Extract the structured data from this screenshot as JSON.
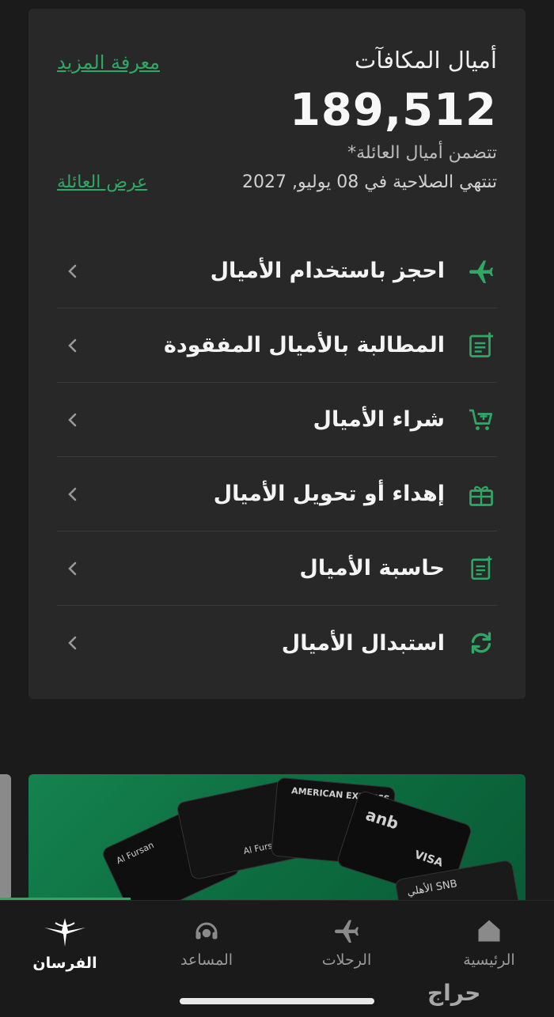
{
  "colors": {
    "accent": "#2fa866",
    "card": "#282828",
    "background": "#1b1b1b"
  },
  "rewards": {
    "title": "أميال المكافآت",
    "learn_more": "معرفة المزيد",
    "miles": "189,512",
    "family_note": "تتضمن أميال العائلة*",
    "expiry": "تنتهي الصلاحية في 08 يوليو, 2027",
    "view_family": "عرض العائلة"
  },
  "menu": [
    {
      "label": "احجز باستخدام الأميال",
      "icon": "airplane-icon"
    },
    {
      "label": "المطالبة بالأميال المفقودة",
      "icon": "document-add-icon"
    },
    {
      "label": "شراء الأميال",
      "icon": "cart-add-icon"
    },
    {
      "label": "إهداء أو تحويل الأميال",
      "icon": "gift-icon"
    },
    {
      "label": "حاسبة الأميال",
      "icon": "calculator-doc-icon"
    },
    {
      "label": "استبدال الأميال",
      "icon": "exchange-icon"
    }
  ],
  "banner": {
    "cards": [
      "Al Fursan",
      "AMERICAN EXPRESS",
      "anb",
      "VISA",
      "SNB الأهلي"
    ]
  },
  "tabs": [
    {
      "label": "الرئيسية",
      "icon": "home-icon"
    },
    {
      "label": "الرحلات",
      "icon": "airplane-icon"
    },
    {
      "label": "المساعد",
      "icon": "headset-icon"
    },
    {
      "label": "الفرسان",
      "icon": "alfursan-logo-icon",
      "active": true
    }
  ],
  "watermark": "حراج"
}
